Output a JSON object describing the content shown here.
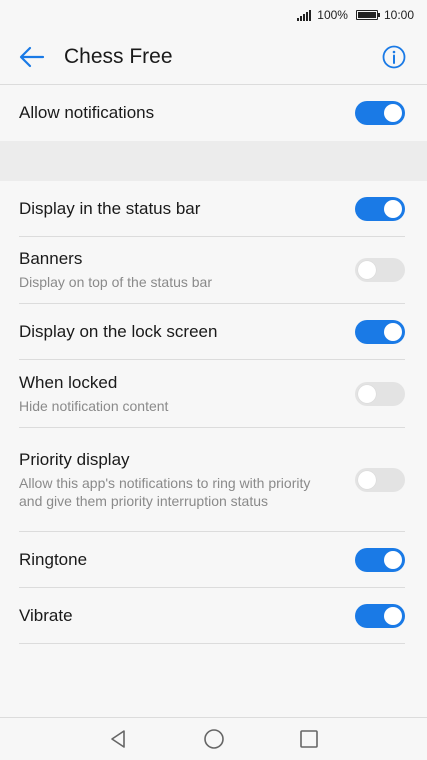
{
  "status_bar": {
    "battery_percent": "100%",
    "time": "10:00",
    "icons": [
      "signal-icon",
      "battery-icon"
    ]
  },
  "header": {
    "title": "Chess Free",
    "back_icon": "arrow-left-icon",
    "info_icon": "info-icon"
  },
  "settings": {
    "allow_notifications": {
      "label": "Allow notifications",
      "enabled": true
    },
    "items": [
      {
        "label": "Display in the status bar",
        "sublabel": "",
        "enabled": true
      },
      {
        "label": "Banners",
        "sublabel": "Display on top of the status bar",
        "enabled": false
      },
      {
        "label": "Display on the lock screen",
        "sublabel": "",
        "enabled": true
      },
      {
        "label": "When locked",
        "sublabel": "Hide notification content",
        "enabled": false
      },
      {
        "label": "Priority display",
        "sublabel": "Allow this app's notifications to ring with priority and give them priority interruption status",
        "enabled": false
      },
      {
        "label": "Ringtone",
        "sublabel": "",
        "enabled": true
      },
      {
        "label": "Vibrate",
        "sublabel": "",
        "enabled": true
      }
    ]
  },
  "nav_bar": {
    "icons": [
      "back-triangle-icon",
      "home-circle-icon",
      "recents-square-icon"
    ]
  },
  "colors": {
    "accent": "#1a7ae6",
    "toggle_off": "#e3e3e3",
    "background": "#f7f7f7",
    "section_gap": "#ececec"
  }
}
